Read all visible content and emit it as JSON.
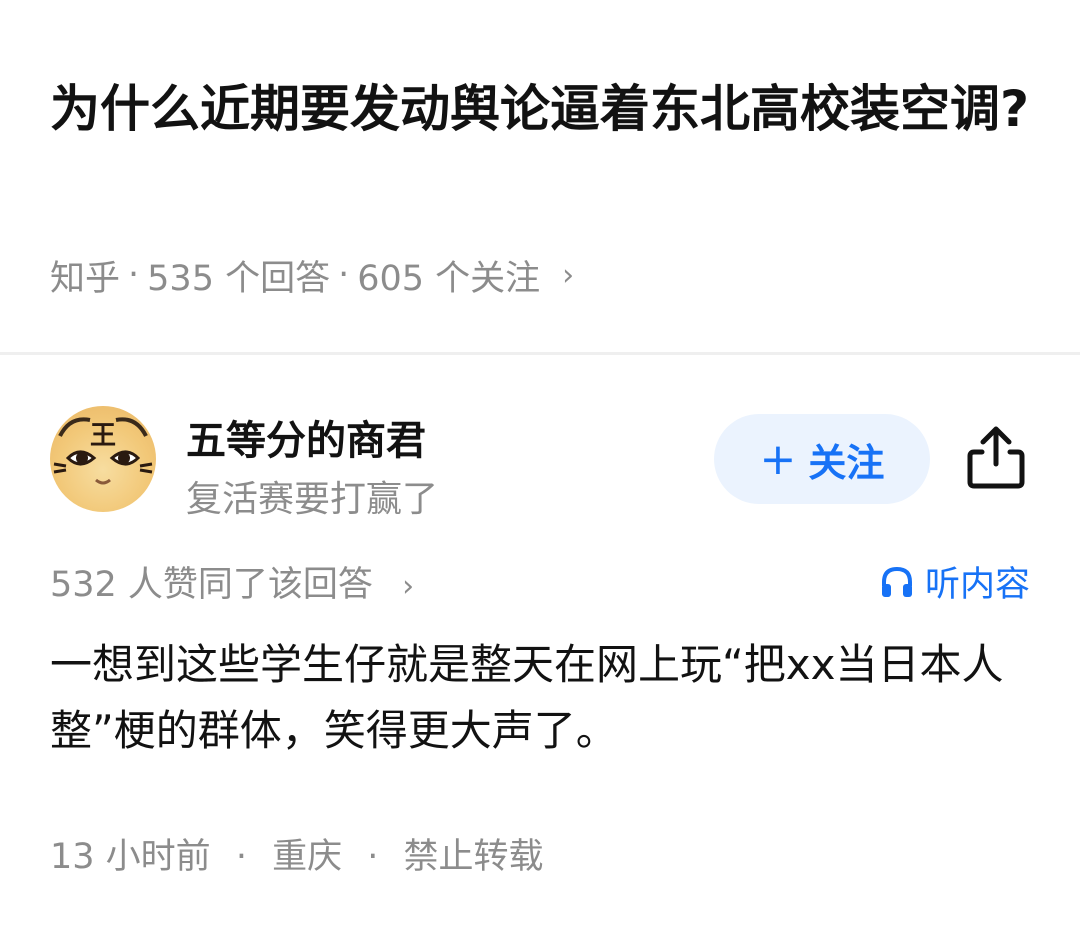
{
  "question": {
    "title": "为什么近期要发动舆论逼着东北高校装空调?",
    "source": "知乎",
    "answers": "535 个回答",
    "follows": "605 个关注",
    "separator": "·"
  },
  "answer": {
    "author": {
      "name": "五等分的商君",
      "bio": "复活赛要打赢了",
      "avatar_glyph": "王"
    },
    "follow_label": "关注",
    "upvotes_text": "532 人赞同了该回答",
    "listen_label": "听内容",
    "content": "一想到这些学生仔就是整天在网上玩“把xx当日本人整”梗的群体，笑得更大声了。",
    "footer": {
      "time": "13 小时前",
      "location": "重庆",
      "copyright": "禁止转载"
    }
  },
  "icons": {
    "chevron": "›",
    "plus": "+",
    "share": "share-icon",
    "headphones": "headphones-icon"
  },
  "colors": {
    "accent": "#1772f6",
    "accent_bg": "#ebf3fe",
    "muted_text": "#8c8c8c",
    "primary_text": "#121212"
  }
}
